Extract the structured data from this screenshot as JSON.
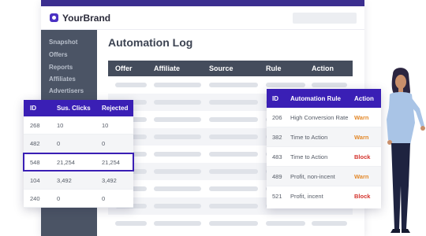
{
  "brand": {
    "name": "YourBrand"
  },
  "sidebar": {
    "items": [
      {
        "label": "Snapshot"
      },
      {
        "label": "Offers"
      },
      {
        "label": "Reports"
      },
      {
        "label": "Affiliates"
      },
      {
        "label": "Advertisers"
      }
    ]
  },
  "main": {
    "title": "Automation Log",
    "columns": [
      "Offer",
      "Affiliate",
      "Source",
      "Rule",
      "Action"
    ]
  },
  "clicks_table": {
    "headers": [
      "ID",
      "Sus. Clicks",
      "Rejected"
    ],
    "rows": [
      {
        "id": "268",
        "clicks": "10",
        "rejected": "10",
        "selected": false
      },
      {
        "id": "482",
        "clicks": "0",
        "rejected": "0",
        "selected": false
      },
      {
        "id": "548",
        "clicks": "21,254",
        "rejected": "21,254",
        "selected": true
      },
      {
        "id": "104",
        "clicks": "3,492",
        "rejected": "3,492",
        "selected": false
      },
      {
        "id": "240",
        "clicks": "0",
        "rejected": "0",
        "selected": false
      }
    ]
  },
  "rules_table": {
    "headers": [
      "ID",
      "Automation Rule",
      "Action"
    ],
    "rows": [
      {
        "id": "206",
        "rule": "High Conversion Rate",
        "action": "Warn"
      },
      {
        "id": "382",
        "rule": "Time to Action",
        "action": "Warn"
      },
      {
        "id": "483",
        "rule": "Time to Action",
        "action": "Block"
      },
      {
        "id": "489",
        "rule": "Profit, non-incent",
        "action": "Warn"
      },
      {
        "id": "521",
        "rule": "Profit, incent",
        "action": "Block"
      }
    ]
  },
  "colors": {
    "brand_purple": "#3a1fb5",
    "sidebar": "#4b5465",
    "warn": "#e3892b",
    "block": "#d4332d"
  }
}
